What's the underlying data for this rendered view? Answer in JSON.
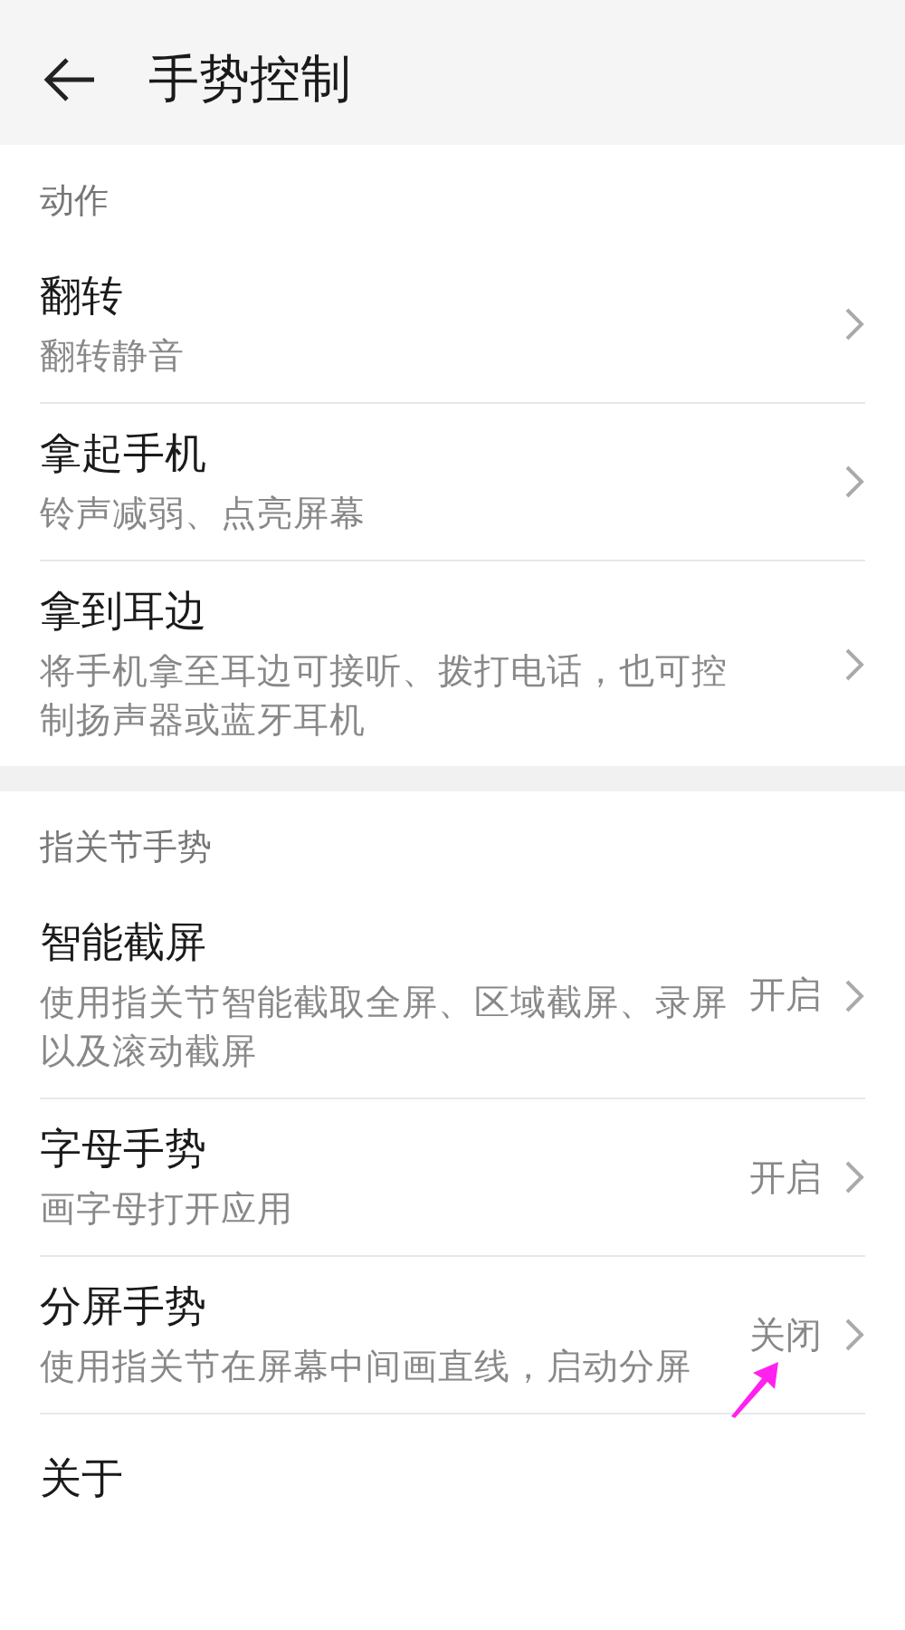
{
  "header": {
    "title": "手势控制"
  },
  "sections": [
    {
      "title": "动作",
      "items": [
        {
          "title": "翻转",
          "subtitle": "翻转静音"
        },
        {
          "title": "拿起手机",
          "subtitle": "铃声减弱、点亮屏幕"
        },
        {
          "title": "拿到耳边",
          "subtitle": "将手机拿至耳边可接听、拨打电话，也可控制扬声器或蓝牙耳机"
        }
      ]
    },
    {
      "title": "指关节手势",
      "items": [
        {
          "title": "智能截屏",
          "subtitle": "使用指关节智能截取全屏、区域截屏、录屏以及滚动截屏",
          "value": "开启"
        },
        {
          "title": "字母手势",
          "subtitle": "画字母打开应用",
          "value": "开启"
        },
        {
          "title": "分屏手势",
          "subtitle": "使用指关节在屏幕中间画直线，启动分屏",
          "value": "关闭",
          "annotated": true
        },
        {
          "title": "关于"
        }
      ]
    }
  ]
}
